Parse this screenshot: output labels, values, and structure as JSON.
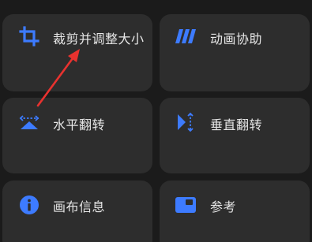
{
  "accent_color": "#3d7bff",
  "annotation_color": "#e8322f",
  "tiles": [
    {
      "label": "裁剪并调整大小",
      "icon": "crop-icon"
    },
    {
      "label": "动画协助",
      "icon": "animation-stripes-icon"
    },
    {
      "label": "水平翻转",
      "icon": "flip-horizontal-icon"
    },
    {
      "label": "垂直翻转",
      "icon": "flip-vertical-icon"
    },
    {
      "label": "画布信息",
      "icon": "info-icon"
    },
    {
      "label": "参考",
      "icon": "reference-icon"
    }
  ]
}
